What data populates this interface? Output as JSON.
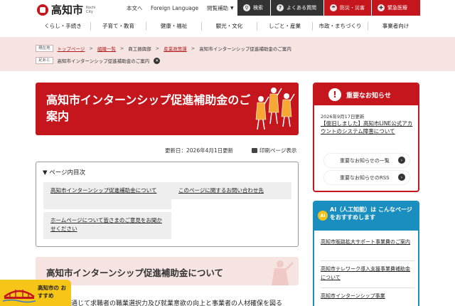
{
  "header": {
    "logo_text": "高知市",
    "logo_sub": "Kochi City",
    "honbun": "本文へ",
    "foreign": "Foreign Language",
    "reading": "閲覧補助",
    "search": "検索",
    "faq": "よくある質問",
    "disaster": "防災・災害",
    "medical": "緊急医療"
  },
  "nav": {
    "items": [
      {
        "label": "くらし・手続き"
      },
      {
        "label": "子育て・教育"
      },
      {
        "label": "健康・福祉"
      },
      {
        "label": "観光・文化"
      },
      {
        "label": "しごと・産業"
      },
      {
        "label": "市政・まちづくり"
      },
      {
        "label": "事業者向け"
      }
    ]
  },
  "breadcrumb": {
    "current_location_label": "現在地",
    "footprint_label": "足あと",
    "items": [
      "トップページ",
      "組織一覧",
      "商工振興部",
      "産業政策課"
    ],
    "current": "高知市インターンシップ促進補助金のご案内",
    "footprint_item": "高知市インターンシップ促進補助金のご案内"
  },
  "page": {
    "title": "高知市インターンシップ促進補助金のご案内",
    "updated": "更新日：2026年4月1日更新",
    "print": "印刷ページ表示"
  },
  "toc": {
    "heading": "▼ ページ内目次",
    "links": [
      "高知市インターンシップ促進補助金について",
      "このページに関するお問い合わせ先",
      "ホームページについて皆さまのご意見をお聞かせください"
    ]
  },
  "section": {
    "heading": "高知市インターンシップ促進補助金について",
    "body_start": "通じて求職者の職業選択力及び就業意欲の向上と事業者の人材確保を図る"
  },
  "notices": {
    "title": "重要なお知らせ",
    "date": "2026年9月17日更新",
    "link": "【復旧しました】高知市LINE公式アカウントのシステム障害について",
    "list_button": "重要なお知らせの一覧",
    "rss_button": "重要なお知らせのRSS"
  },
  "ai": {
    "badge": "AI",
    "title": "AI（人工知能）は こんなページをおすすめします",
    "links": [
      "高知市販路拡大サポート事業費のご案内",
      "高知市テレワーク導入支援事業費補助金について",
      "高知市インターンシップ事業"
    ]
  },
  "recommend": {
    "label": "高知市の おすすめ"
  },
  "colors": {
    "brand_red": "#c4161c",
    "ai_blue": "#1a8fbf",
    "band_pink": "#f6e4e3",
    "recommend_yellow": "#f5c518"
  }
}
